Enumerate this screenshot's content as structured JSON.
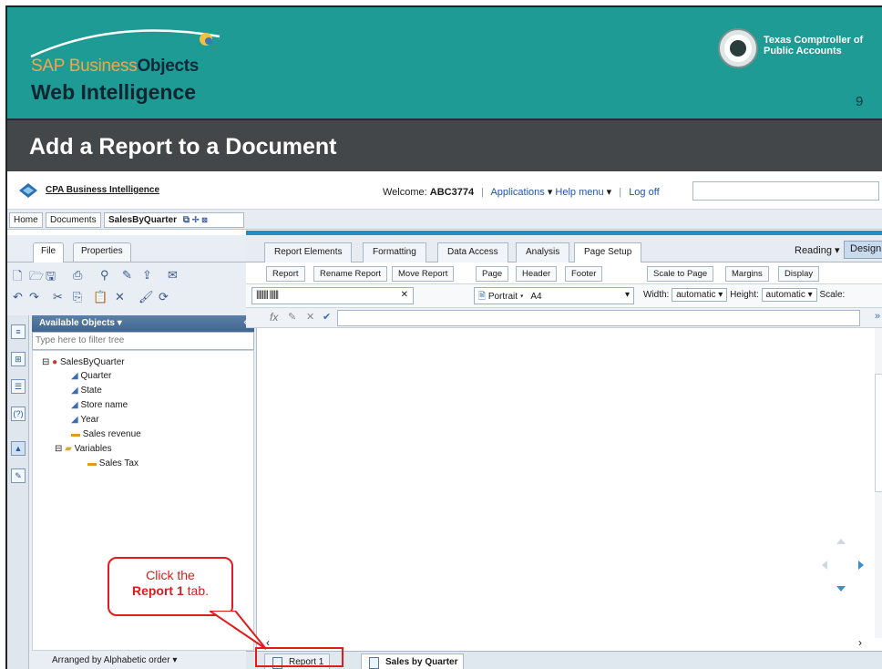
{
  "slide": {
    "brand_part1": "SAP Business",
    "brand_part2": "Objects",
    "product": "Web Intelligence",
    "org": "Texas Comptroller of Public Accounts",
    "page_number": "9",
    "title": "Add a Report to a Document"
  },
  "app": {
    "name": "CPA Business Intelligence",
    "welcome_label": "Welcome:",
    "user": "ABC3774",
    "applications": "Applications",
    "help_menu": "Help menu",
    "logoff": "Log off",
    "search_value": ""
  },
  "doc_tabs": [
    "Home",
    "Documents",
    "SalesByQuarter"
  ],
  "left_tabs": [
    "File",
    "Properties"
  ],
  "available_objects": {
    "title": "Available Objects",
    "filter_placeholder": "Type here to filter tree",
    "root": "SalesByQuarter",
    "items": [
      "Quarter",
      "State",
      "Store name",
      "Year",
      "Sales revenue"
    ],
    "variables_folder": "Variables",
    "variables": [
      "Sales Tax"
    ],
    "arranged_by": "Arranged by Alphabetic order"
  },
  "mode": {
    "reading": "Reading",
    "design": "Design"
  },
  "main_tabs": [
    "Report Elements",
    "Formatting",
    "Data Access",
    "Analysis",
    "Page Setup"
  ],
  "report_tabs": [
    "Report",
    "Rename Report",
    "Move Report"
  ],
  "page_tabs": [
    "Page",
    "Header",
    "Footer"
  ],
  "scale_tabs": [
    "Scale to Page",
    "Margins",
    "Display"
  ],
  "controls": {
    "orientation": "Portrait",
    "paper": "A4",
    "width_label": "Width:",
    "width_value": "automatic",
    "height_label": "Height:",
    "height_value": "automatic",
    "scale_label": "Scale:"
  },
  "formula_bar": {
    "fx": "fx",
    "value": ""
  },
  "bottom_tabs": [
    "Report 1",
    "Sales by Quarter"
  ],
  "callout": {
    "line1": "Click the",
    "bold": "Report 1",
    "line2": "tab."
  }
}
